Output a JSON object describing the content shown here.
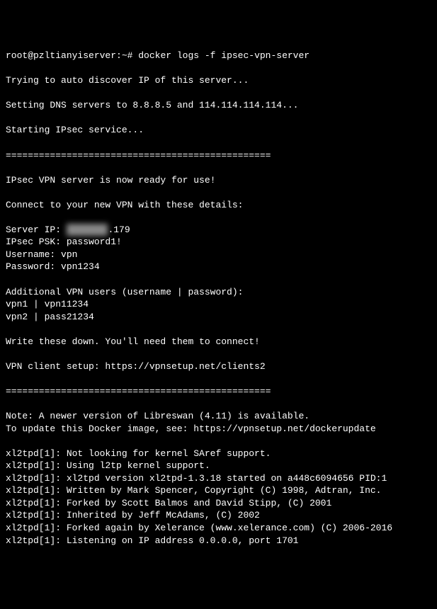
{
  "terminal": {
    "prompt_line_partial": "root@pzltianyiserver:~#",
    "command_prev_partial": "...",
    "prompt_line": "root@pzltianyiserver:~#",
    "command": "docker logs -f ipsec-vpn-server",
    "lines": {
      "trying": "Trying to auto discover IP of this server...",
      "dns": "Setting DNS servers to 8.8.8.5 and 114.114.114.114...",
      "starting": "Starting IPsec service...",
      "divider1": "================================================",
      "ready": "IPsec VPN server is now ready for use!",
      "connect": "Connect to your new VPN with these details:",
      "server_ip_label": "Server IP: ",
      "server_ip_masked": "xxx.xxx",
      "server_ip_suffix": ".179",
      "psk": "IPsec PSK: password1!",
      "username": "Username: vpn",
      "password": "Password: vpn1234",
      "additional": "Additional VPN users (username | password):",
      "vpn1": "vpn1 | vpn11234",
      "vpn2": "vpn2 | pass21234",
      "write": "Write these down. You'll need them to connect!",
      "client_setup": "VPN client setup: https://vpnsetup.net/clients2",
      "divider2": "================================================",
      "note": "Note: A newer version of Libreswan (4.11) is available.",
      "update": "To update this Docker image, see: https://vpnsetup.net/dockerupdate",
      "xl1": "xl2tpd[1]: Not looking for kernel SAref support.",
      "xl2": "xl2tpd[1]: Using l2tp kernel support.",
      "xl3": "xl2tpd[1]: xl2tpd version xl2tpd-1.3.18 started on a448c6094656 PID:1",
      "xl4": "xl2tpd[1]: Written by Mark Spencer, Copyright (C) 1998, Adtran, Inc.",
      "xl5": "xl2tpd[1]: Forked by Scott Balmos and David Stipp, (C) 2001",
      "xl6": "xl2tpd[1]: Inherited by Jeff McAdams, (C) 2002",
      "xl7": "xl2tpd[1]: Forked again by Xelerance (www.xelerance.com) (C) 2006-2016",
      "xl8": "xl2tpd[1]: Listening on IP address 0.0.0.0, port 1701"
    }
  }
}
